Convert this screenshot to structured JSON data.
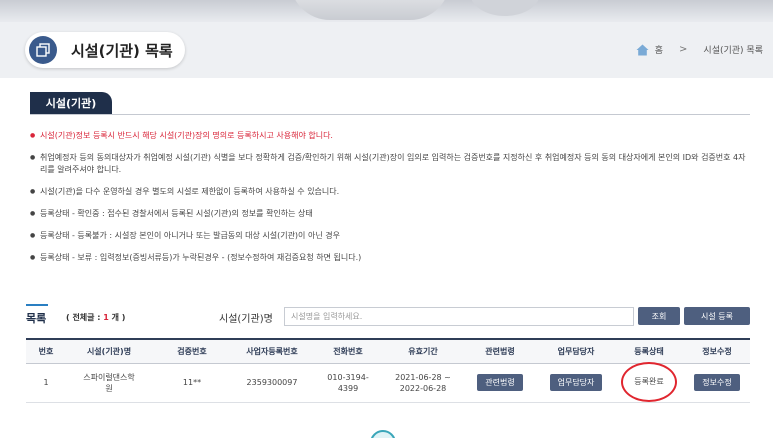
{
  "header": {
    "title": "시설(기관) 목록",
    "breadcrumb": {
      "home": "홈",
      "separator": ">",
      "current": "시설(기관) 목록"
    }
  },
  "section": {
    "tab_label": "시설(기관)"
  },
  "notices": [
    "시설(기관)정보 등록시 반드시 해당 시설(기관)장의 명의로 등록하시고 사용해야 합니다.",
    "취업예정자 등의 동의대상자가 취업예정 시설(기관) 식별을 보다 정확하게 검증/확인하기 위해 시설(기관)장이 임의로 입력하는 검증번호를 지정하신 후 취업예정자 등의 동의 대상자에게 본인의 ID와 검증번호 4자리를 알려주셔야 합니다.",
    "시설(기관)을 다수 운영하실 경우 별도의 시설로 제한없이 등록하여 사용하실 수 있습니다.",
    "등록상태 - 확인중 : 접수된 경찰서에서 등록된 시설(기관)의 정보를 확인하는 상태",
    "등록상태 - 등록불가 : 시설장 본인이 아니거나 또는 발급동의 대상 시설(기관)이 아닌 경우",
    "등록상태 - 보류 : 입력정보(증빙서류등)가 누락된경우 - (정보수정하여 재검증요청 하면 됩니다.)"
  ],
  "list": {
    "title": "목록",
    "total_prefix": "( 전체글 : ",
    "total_count": "1",
    "total_suffix": " 개 )",
    "search_label": "시설(기관)명",
    "search_placeholder": "시설명을 입력하세요.",
    "search_button": "조회",
    "register_button": "시설 등록"
  },
  "table": {
    "headers": [
      "번호",
      "시설(기관)명",
      "검증번호",
      "사업자등록번호",
      "전화번호",
      "유효기간",
      "관련법령",
      "업무담당자",
      "등록상태",
      "정보수정"
    ],
    "rows": [
      {
        "no": "1",
        "name_line1": "스파이럴댄스학",
        "name_line2": "원",
        "verify": "11**",
        "biz_no": "2359300097",
        "phone_line1": "010-3194-",
        "phone_line2": "4399",
        "period_line1": "2021-06-28 ~",
        "period_line2": "2022-06-28",
        "law_button": "관련법령",
        "manager_button": "업무담당자",
        "status": "등록완료",
        "edit_button": "정보수정"
      }
    ]
  },
  "colors": {
    "navy": "#1f2f4a",
    "button": "#4e5f7f",
    "warning": "#d9263a",
    "status_circle": "#e0262f",
    "accent_blue": "#2a7fc2"
  },
  "icons": {
    "title": "window-stack-icon",
    "home": "home-icon"
  }
}
